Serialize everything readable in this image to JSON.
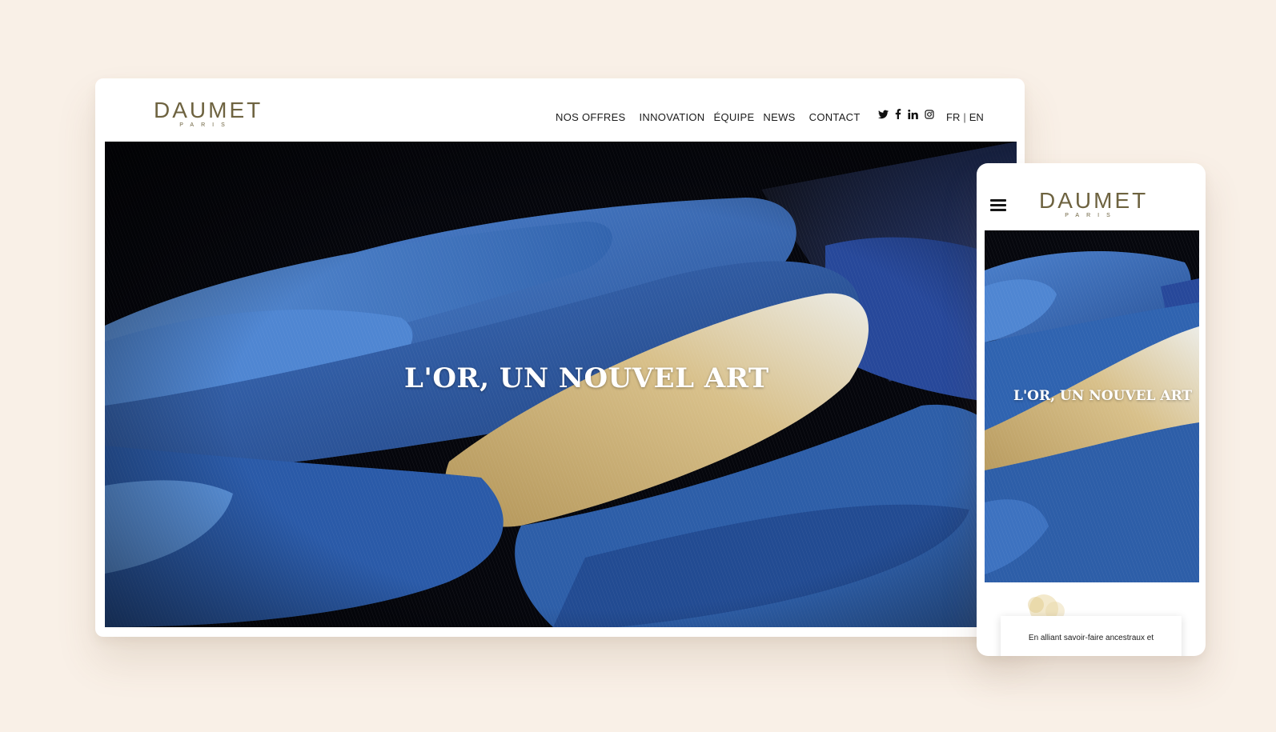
{
  "brand": {
    "name": "DAUMET",
    "subtitle": "PARIS",
    "color": "#6e6340"
  },
  "desktop": {
    "nav": {
      "items": [
        "NOS OFFRES",
        "INNOVATION",
        "ÉQUIPE",
        "NEWS",
        "CONTACT"
      ]
    },
    "social_icons": [
      "twitter-icon",
      "facebook-icon",
      "linkedin-icon",
      "instagram-icon"
    ],
    "lang": {
      "fr": "FR",
      "separator": "|",
      "en": "EN"
    },
    "hero": {
      "title": "L'OR, UN NOUVEL ART"
    }
  },
  "mobile": {
    "menu_icon": "hamburger-icon",
    "hero": {
      "title": "L'OR, UN NOUVEL ART"
    },
    "card_text": "En alliant savoir-faire ancestraux et"
  },
  "colors": {
    "background": "#f9f0e7",
    "feather_blue": "#2f5ea8",
    "feather_gold": "#c8ad6e"
  }
}
